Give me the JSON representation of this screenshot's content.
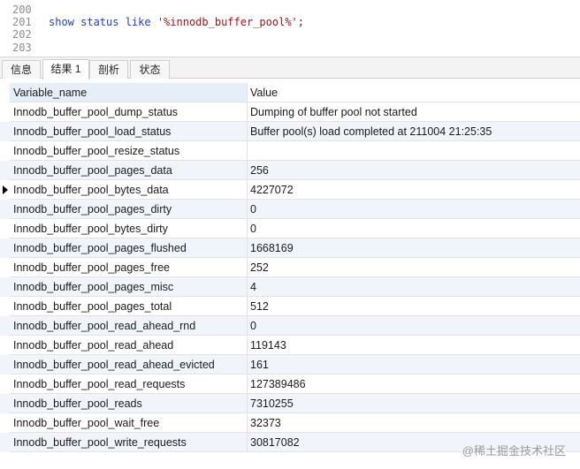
{
  "editor": {
    "lines": [
      {
        "number": "200",
        "code": ""
      },
      {
        "number": "201",
        "keyword": "show status like ",
        "string": "'%innodb_buffer_pool%'",
        "terminator": ";"
      },
      {
        "number": "202",
        "code": ""
      },
      {
        "number": "203",
        "code": ""
      }
    ]
  },
  "tabs": [
    {
      "label": "信息",
      "active": false
    },
    {
      "label": "结果 1",
      "active": true
    },
    {
      "label": "剖析",
      "active": false
    },
    {
      "label": "状态",
      "active": false
    }
  ],
  "grid": {
    "columns": [
      "Variable_name",
      "Value"
    ],
    "current_row": 4,
    "rows": [
      [
        "Innodb_buffer_pool_dump_status",
        "Dumping of buffer pool not started"
      ],
      [
        "Innodb_buffer_pool_load_status",
        "Buffer pool(s) load completed at 211004 21:25:35"
      ],
      [
        "Innodb_buffer_pool_resize_status",
        ""
      ],
      [
        "Innodb_buffer_pool_pages_data",
        "256"
      ],
      [
        "Innodb_buffer_pool_bytes_data",
        "4227072"
      ],
      [
        "Innodb_buffer_pool_pages_dirty",
        "0"
      ],
      [
        "Innodb_buffer_pool_bytes_dirty",
        "0"
      ],
      [
        "Innodb_buffer_pool_pages_flushed",
        "1668169"
      ],
      [
        "Innodb_buffer_pool_pages_free",
        "252"
      ],
      [
        "Innodb_buffer_pool_pages_misc",
        "4"
      ],
      [
        "Innodb_buffer_pool_pages_total",
        "512"
      ],
      [
        "Innodb_buffer_pool_read_ahead_rnd",
        "0"
      ],
      [
        "Innodb_buffer_pool_read_ahead",
        "119143"
      ],
      [
        "Innodb_buffer_pool_read_ahead_evicted",
        "161"
      ],
      [
        "Innodb_buffer_pool_read_requests",
        "127389486"
      ],
      [
        "Innodb_buffer_pool_reads",
        "7310255"
      ],
      [
        "Innodb_buffer_pool_wait_free",
        "32373"
      ],
      [
        "Innodb_buffer_pool_write_requests",
        "30817082"
      ]
    ]
  },
  "watermark": "@稀土掘金技术社区"
}
